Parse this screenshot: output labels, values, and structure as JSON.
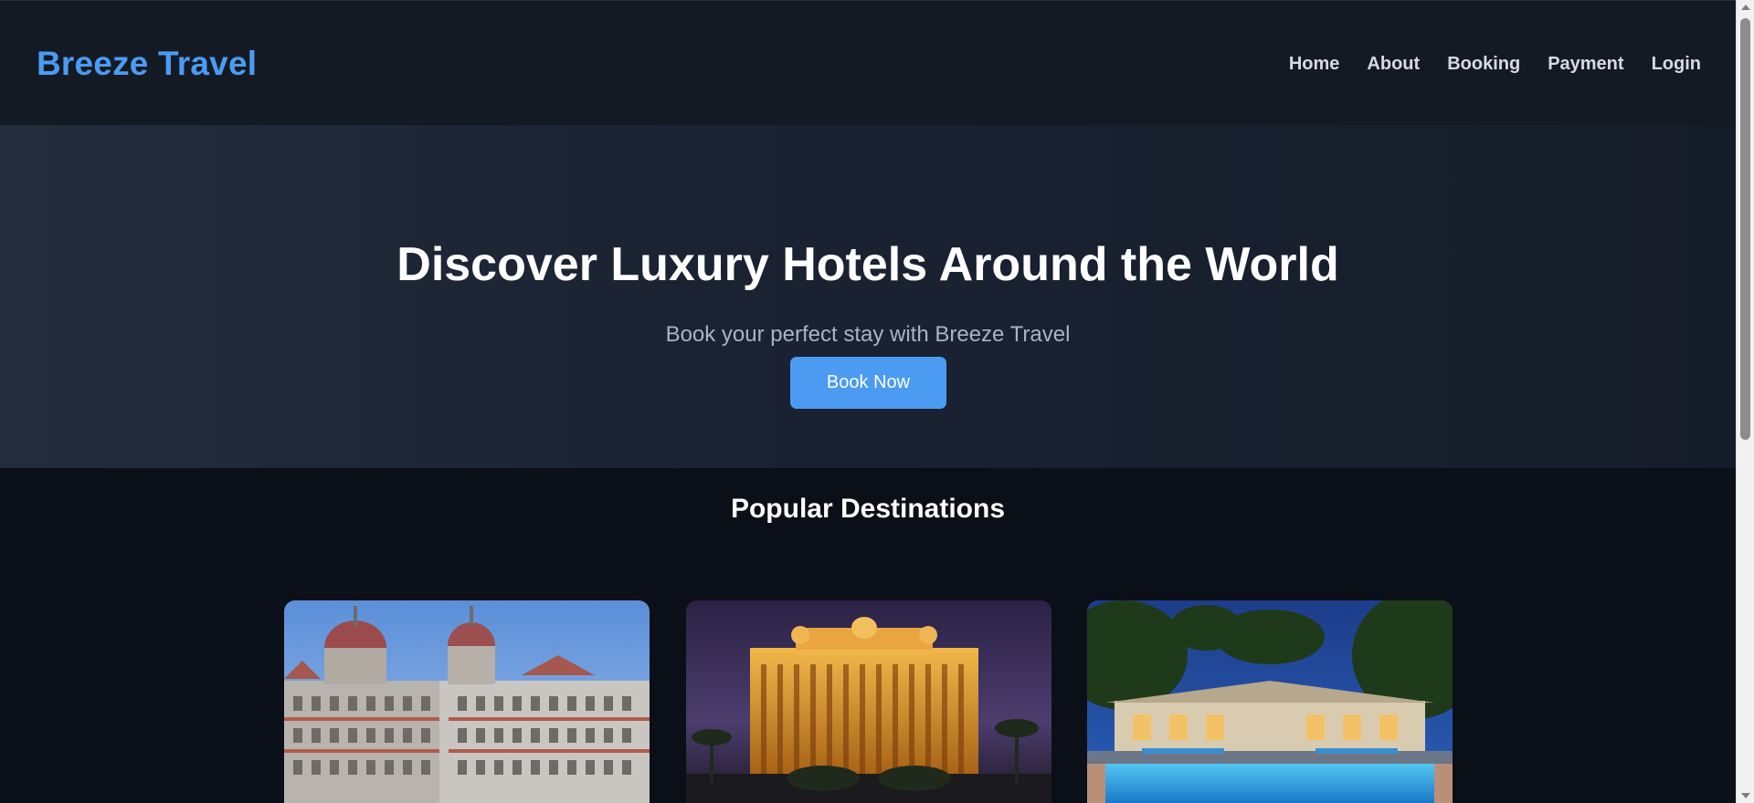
{
  "navbar": {
    "brand": "Breeze Travel",
    "links": [
      "Home",
      "About",
      "Booking",
      "Payment",
      "Login"
    ]
  },
  "hero": {
    "title": "Discover Luxury Hotels Around the World",
    "subtitle": "Book your perfect stay with Breeze Travel",
    "button_label": "Book Now"
  },
  "destinations": {
    "title": "Popular Destinations",
    "cards": [
      {
        "image": "palace-hotel-photo"
      },
      {
        "image": "golden-hotel-night-photo"
      },
      {
        "image": "resort-pool-night-photo"
      }
    ]
  },
  "colors": {
    "accent": "#4b9bf2",
    "navbar_bg": "#141a24",
    "page_bg": "#0b0f17",
    "hero_bg": "#1b2333"
  }
}
